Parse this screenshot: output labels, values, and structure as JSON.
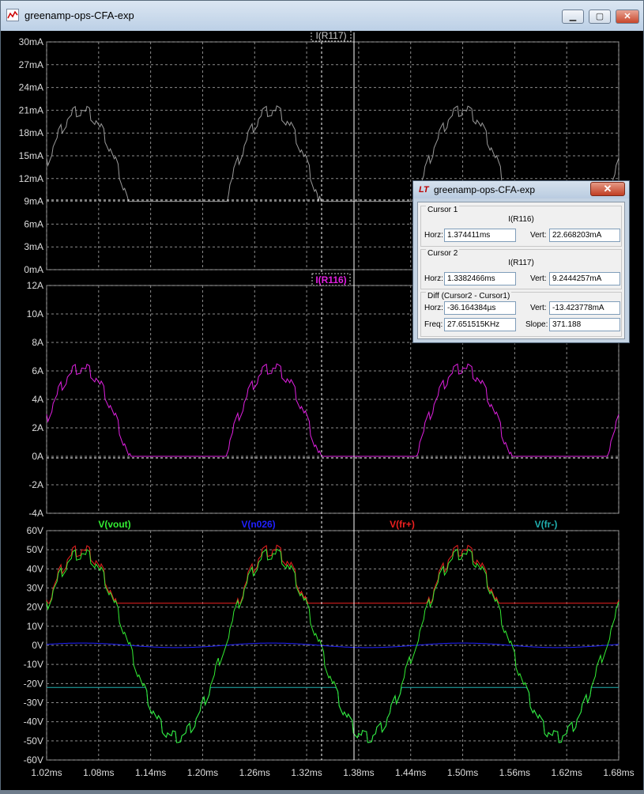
{
  "window": {
    "title": "greenamp-ops-CFA-exp",
    "min": "▁",
    "max": "▢",
    "close": "✕"
  },
  "colors": {
    "bg": "#000000",
    "grid": "#8c8c8c",
    "r117": "#9a9a9a",
    "r116": "#e020e0",
    "vout": "#33ee33",
    "n026": "#2020ff",
    "frp": "#ee2020",
    "frm": "#20b0b0"
  },
  "panels": {
    "top": {
      "trace_label": "I(R117)",
      "y_ticks": [
        "30mA",
        "27mA",
        "24mA",
        "21mA",
        "18mA",
        "15mA",
        "12mA",
        "9mA",
        "6mA",
        "3mA",
        "0mA"
      ]
    },
    "mid": {
      "trace_label": "I(R116)",
      "y_ticks": [
        "12A",
        "10A",
        "8A",
        "6A",
        "4A",
        "2A",
        "0A",
        "-2A",
        "-4A"
      ]
    },
    "bot": {
      "trace_labels": [
        "V(vout)",
        "V(n026)",
        "V(fr+)",
        "V(fr-)"
      ],
      "y_ticks": [
        "60V",
        "50V",
        "40V",
        "30V",
        "20V",
        "10V",
        "0V",
        "-10V",
        "-20V",
        "-30V",
        "-40V",
        "-50V",
        "-60V"
      ]
    },
    "x_ticks": [
      "1.02ms",
      "1.08ms",
      "1.14ms",
      "1.20ms",
      "1.26ms",
      "1.32ms",
      "1.38ms",
      "1.44ms",
      "1.50ms",
      "1.56ms",
      "1.62ms",
      "1.68ms"
    ]
  },
  "cursor_dialog": {
    "title": "greenamp-ops-CFA-exp",
    "icon_text": "LT",
    "close": "✕",
    "cursor1": {
      "label": "Cursor 1",
      "trace": "I(R116)",
      "horz_label": "Horz:",
      "horz": "1.374411ms",
      "vert_label": "Vert:",
      "vert": "22.668203mA"
    },
    "cursor2": {
      "label": "Cursor 2",
      "trace": "I(R117)",
      "horz_label": "Horz:",
      "horz": "1.3382466ms",
      "vert_label": "Vert:",
      "vert": "9.2444257mA"
    },
    "diff": {
      "label": "Diff (Cursor2 - Cursor1)",
      "horz_label": "Horz:",
      "horz": "-36.164384µs",
      "vert_label": "Vert:",
      "vert": "-13.423778mA",
      "freq_label": "Freq:",
      "freq": "27.651515KHz",
      "slope_label": "Slope:",
      "slope": "371.188"
    }
  },
  "chart_data": [
    {
      "type": "line",
      "series": [
        {
          "name": "I(R117)"
        }
      ],
      "ylim": [
        0,
        30
      ],
      "xlim": [
        1.02,
        1.68
      ],
      "y_unit": "mA",
      "x_unit": "ms",
      "grid": true
    },
    {
      "type": "line",
      "series": [
        {
          "name": "I(R116)"
        }
      ],
      "ylim": [
        -4,
        12
      ],
      "xlim": [
        1.02,
        1.68
      ],
      "y_unit": "A",
      "x_unit": "ms",
      "grid": true
    },
    {
      "type": "line",
      "series": [
        {
          "name": "V(vout)"
        },
        {
          "name": "V(n026)"
        },
        {
          "name": "V(fr+)"
        },
        {
          "name": "V(fr-)"
        }
      ],
      "ylim": [
        -60,
        60
      ],
      "xlim": [
        1.02,
        1.68
      ],
      "y_unit": "V",
      "x_unit": "ms",
      "grid": true
    }
  ]
}
